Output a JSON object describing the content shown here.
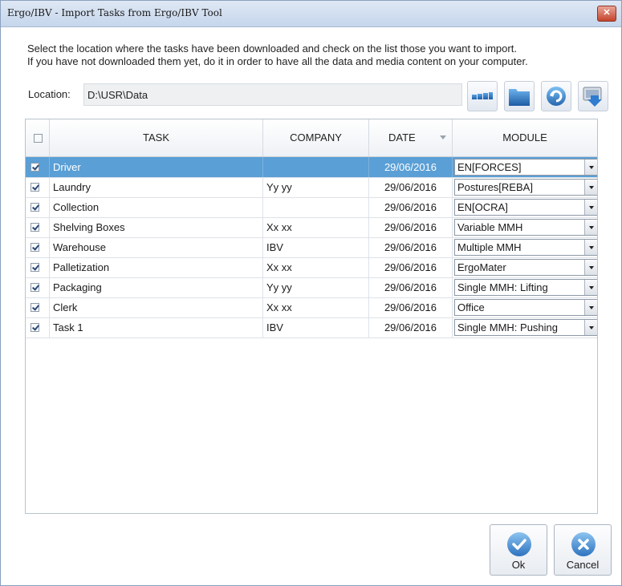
{
  "window": {
    "title": "Ergo/IBV - Import Tasks from Ergo/IBV Tool",
    "close_glyph": "✕"
  },
  "instructions": {
    "line1": "Select the location where the tasks have been downloaded and check on the list those you want to import.",
    "line2": "If you have not downloaded them yet, do it in order to have all the data and media content on your computer."
  },
  "location": {
    "label": "Location:",
    "value": "D:\\USR\\Data"
  },
  "toolbar_icons": [
    "dots-folder-icon",
    "folder-icon",
    "refresh-icon",
    "download-device-icon"
  ],
  "table": {
    "headers": {
      "task": "TASK",
      "company": "COMPANY",
      "date": "DATE",
      "module": "MODULE"
    },
    "rows": [
      {
        "checked": true,
        "task": "Driver",
        "company": "",
        "date": "29/06/2016",
        "module": "EN[FORCES]"
      },
      {
        "checked": true,
        "task": "Laundry",
        "company": "Yy yy",
        "date": "29/06/2016",
        "module": "Postures[REBA]"
      },
      {
        "checked": true,
        "task": "Collection",
        "company": "",
        "date": "29/06/2016",
        "module": "EN[OCRA]"
      },
      {
        "checked": true,
        "task": "Shelving Boxes",
        "company": "Xx xx",
        "date": "29/06/2016",
        "module": "Variable MMH"
      },
      {
        "checked": true,
        "task": "Warehouse",
        "company": "IBV",
        "date": "29/06/2016",
        "module": "Multiple MMH"
      },
      {
        "checked": true,
        "task": "Palletization",
        "company": "Xx xx",
        "date": "29/06/2016",
        "module": "ErgoMater"
      },
      {
        "checked": true,
        "task": "Packaging",
        "company": "Yy yy",
        "date": "29/06/2016",
        "module": "Single MMH: Lifting"
      },
      {
        "checked": true,
        "task": "Clerk",
        "company": "Xx xx",
        "date": "29/06/2016",
        "module": "Office"
      },
      {
        "checked": true,
        "task": "Task 1",
        "company": "IBV",
        "date": "29/06/2016",
        "module": "Single MMH: Pushing"
      }
    ],
    "selected_row": "Driver"
  },
  "buttons": {
    "ok": "Ok",
    "cancel": "Cancel"
  },
  "colors": {
    "selection": "#5a9fd6",
    "ok_icon": "#4a8fd0",
    "cancel_icon": "#4a8fd0"
  }
}
